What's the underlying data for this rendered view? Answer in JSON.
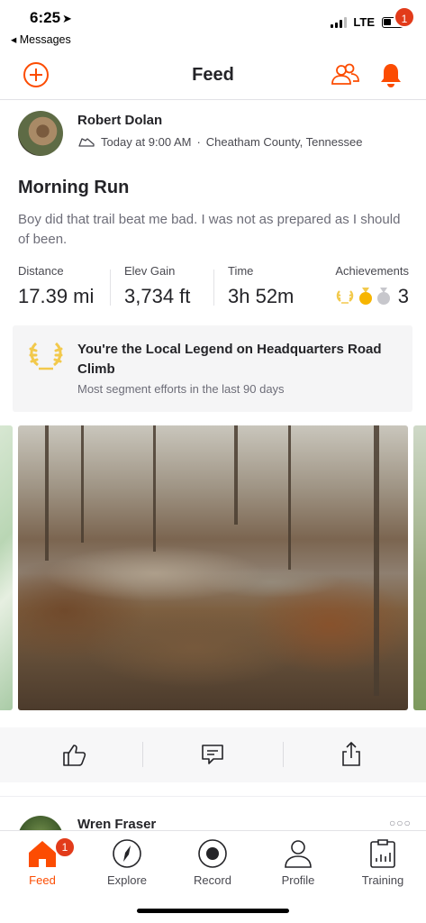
{
  "status_bar": {
    "time": "6:25",
    "back_label": "Messages",
    "network": "LTE",
    "battery_level": 0.35
  },
  "header": {
    "title": "Feed",
    "notification_count": "1",
    "accent_color": "#fc4c02"
  },
  "activity": {
    "athlete_name": "Robert Dolan",
    "timestamp": "Today at 9:00 AM",
    "location": "Cheatham County, Tennessee",
    "title": "Morning Run",
    "description": "Boy did that trail beat me bad. I was not as prepared as I should of been.",
    "stats": [
      {
        "label": "Distance",
        "value": "17.39 mi"
      },
      {
        "label": "Elev Gain",
        "value": "3,734 ft"
      },
      {
        "label": "Time",
        "value": "3h 52m"
      }
    ],
    "achievements": {
      "label": "Achievements",
      "count": "3",
      "icons": [
        "laurel-icon",
        "gold-medal-icon",
        "silver-medal-icon"
      ]
    },
    "local_legend": {
      "title": "You're the Local Legend on Headquarters Road Climb",
      "subtitle": "Most segment efforts in the last 90 days",
      "icon": "laurel-icon"
    },
    "actions": [
      "thumbs-up-icon",
      "comment-icon",
      "share-icon"
    ]
  },
  "next_entry": {
    "athlete_name": "Wren Fraser",
    "more": "..."
  },
  "tabs": [
    {
      "label": "Feed",
      "icon": "home-icon",
      "badge": "1",
      "active": true
    },
    {
      "label": "Explore",
      "icon": "compass-icon"
    },
    {
      "label": "Record",
      "icon": "record-icon"
    },
    {
      "label": "Profile",
      "icon": "profile-icon"
    },
    {
      "label": "Training",
      "icon": "training-icon"
    }
  ]
}
